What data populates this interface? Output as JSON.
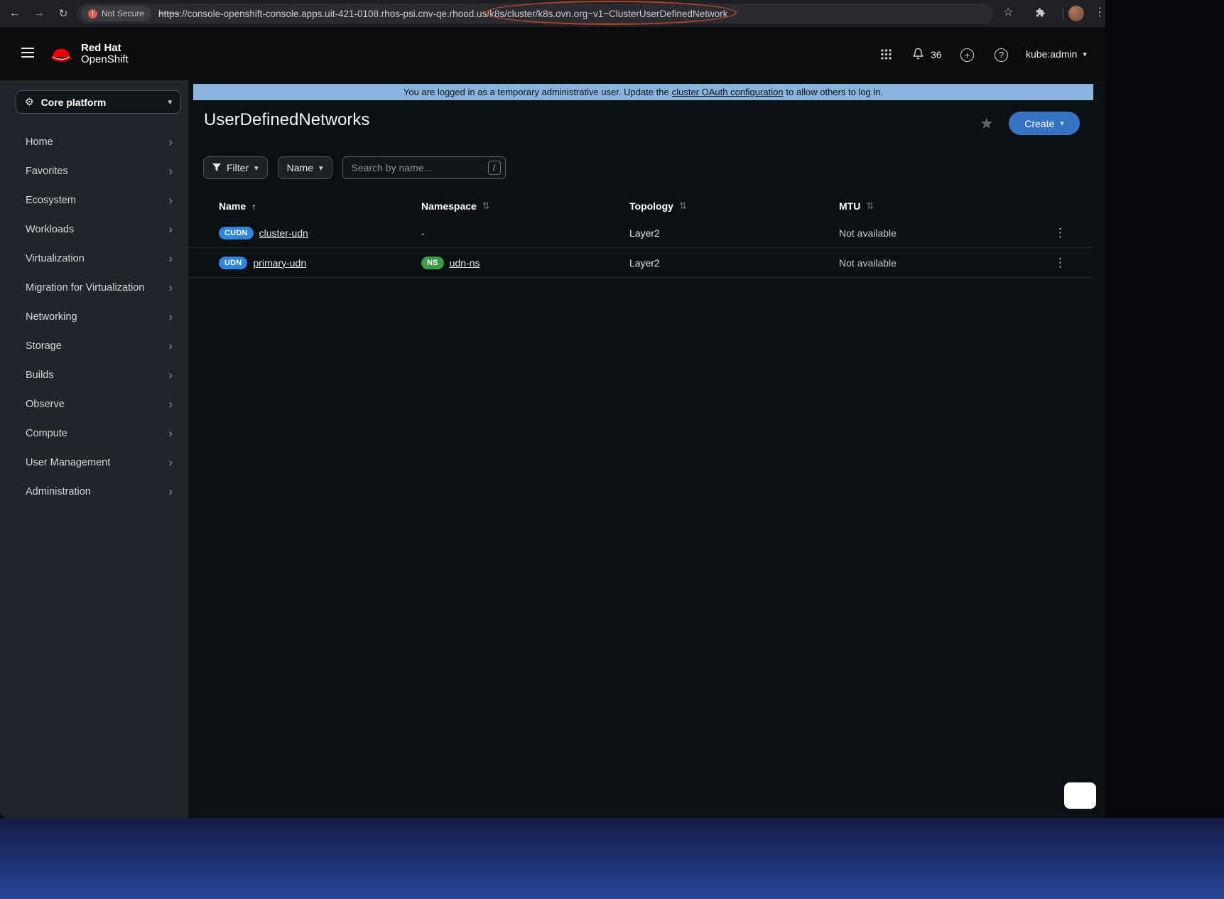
{
  "browser": {
    "security_label": "Not Secure",
    "url_scheme": "https",
    "url_rest": "://console-openshift-console.apps.uit-421-0108.rhos-psi.cnv-qe.rhood.us/k8s/cluster/k8s.ovn.org~v1~ClusterUserDefinedNetwork"
  },
  "icons": {
    "back": "←",
    "forward": "→",
    "reload": "↻",
    "bookmark_star": "☆",
    "kebab": "⋮",
    "warning": "!",
    "caret_down": "▾",
    "chevron_right": "›",
    "gear": "⚙",
    "plus": "+",
    "help": "?",
    "sort_asc": "↑",
    "sort_none": "⇅",
    "favorite_star": "★"
  },
  "masthead": {
    "brand_top": "Red Hat",
    "brand_bottom": "OpenShift",
    "notification_count": "36",
    "username": "kube:admin"
  },
  "sidebar": {
    "perspective": "Core platform",
    "items": [
      {
        "label": "Home"
      },
      {
        "label": "Favorites"
      },
      {
        "label": "Ecosystem"
      },
      {
        "label": "Workloads"
      },
      {
        "label": "Virtualization"
      },
      {
        "label": "Migration for Virtualization"
      },
      {
        "label": "Networking"
      },
      {
        "label": "Storage"
      },
      {
        "label": "Builds"
      },
      {
        "label": "Observe"
      },
      {
        "label": "Compute"
      },
      {
        "label": "User Management"
      },
      {
        "label": "Administration"
      }
    ]
  },
  "banner": {
    "prefix": "You are logged in as a temporary administrative user. Update the",
    "link_text": "cluster OAuth configuration",
    "suffix": "to allow others to log in."
  },
  "page": {
    "title": "UserDefinedNetworks",
    "create_button": "Create"
  },
  "toolbar": {
    "filter_button": "Filter",
    "attribute_dropdown": "Name",
    "search_placeholder": "Search by name...",
    "search_shortcut": "/"
  },
  "table": {
    "columns": [
      {
        "label": "Name",
        "sort": "asc"
      },
      {
        "label": "Namespace",
        "sort": "none"
      },
      {
        "label": "Topology",
        "sort": "none"
      },
      {
        "label": "MTU",
        "sort": "none"
      }
    ],
    "rows": [
      {
        "kind_badge": "CUDN",
        "name": "cluster-udn",
        "namespace_text": "-",
        "topology": "Layer2",
        "mtu": "Not available"
      },
      {
        "kind_badge": "UDN",
        "name": "primary-udn",
        "namespace_badge": "NS",
        "namespace_link": "udn-ns",
        "topology": "Layer2",
        "mtu": "Not available"
      }
    ]
  },
  "colors": {
    "accent_blue": "#3574c4",
    "badge_blue": "#2d85dd",
    "badge_green": "#3d9c47",
    "banner_blue": "#8ab4dd",
    "annotation_red": "#b5432c"
  }
}
